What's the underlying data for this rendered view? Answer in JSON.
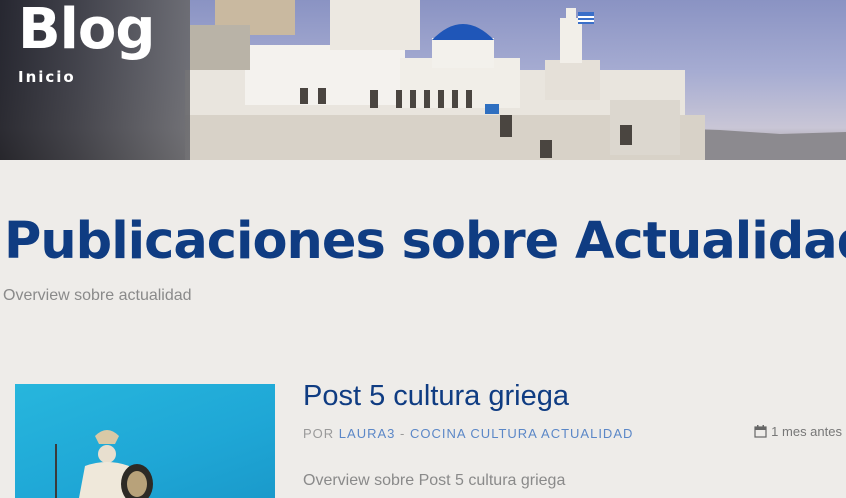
{
  "hero": {
    "title": "Blog",
    "breadcrumb": "Inicio"
  },
  "page": {
    "title": "Publicaciones sobre Actualidad",
    "subtitle": "Overview sobre actualidad"
  },
  "posts": [
    {
      "title": "Post 5 cultura griega",
      "by_label": "POR",
      "author": "LAURA3",
      "separator": "-",
      "categories": "COCINA CULTURA ACTUALIDAD",
      "date": "1 mes antes",
      "date_icon": "calendar-icon",
      "excerpt": "Overview sobre Post 5 cultura griega"
    }
  ],
  "colors": {
    "heading_blue": "#0f3c82",
    "link_blue": "#5b87c7",
    "muted_text": "#8a8a8a",
    "background": "#eeece9"
  }
}
